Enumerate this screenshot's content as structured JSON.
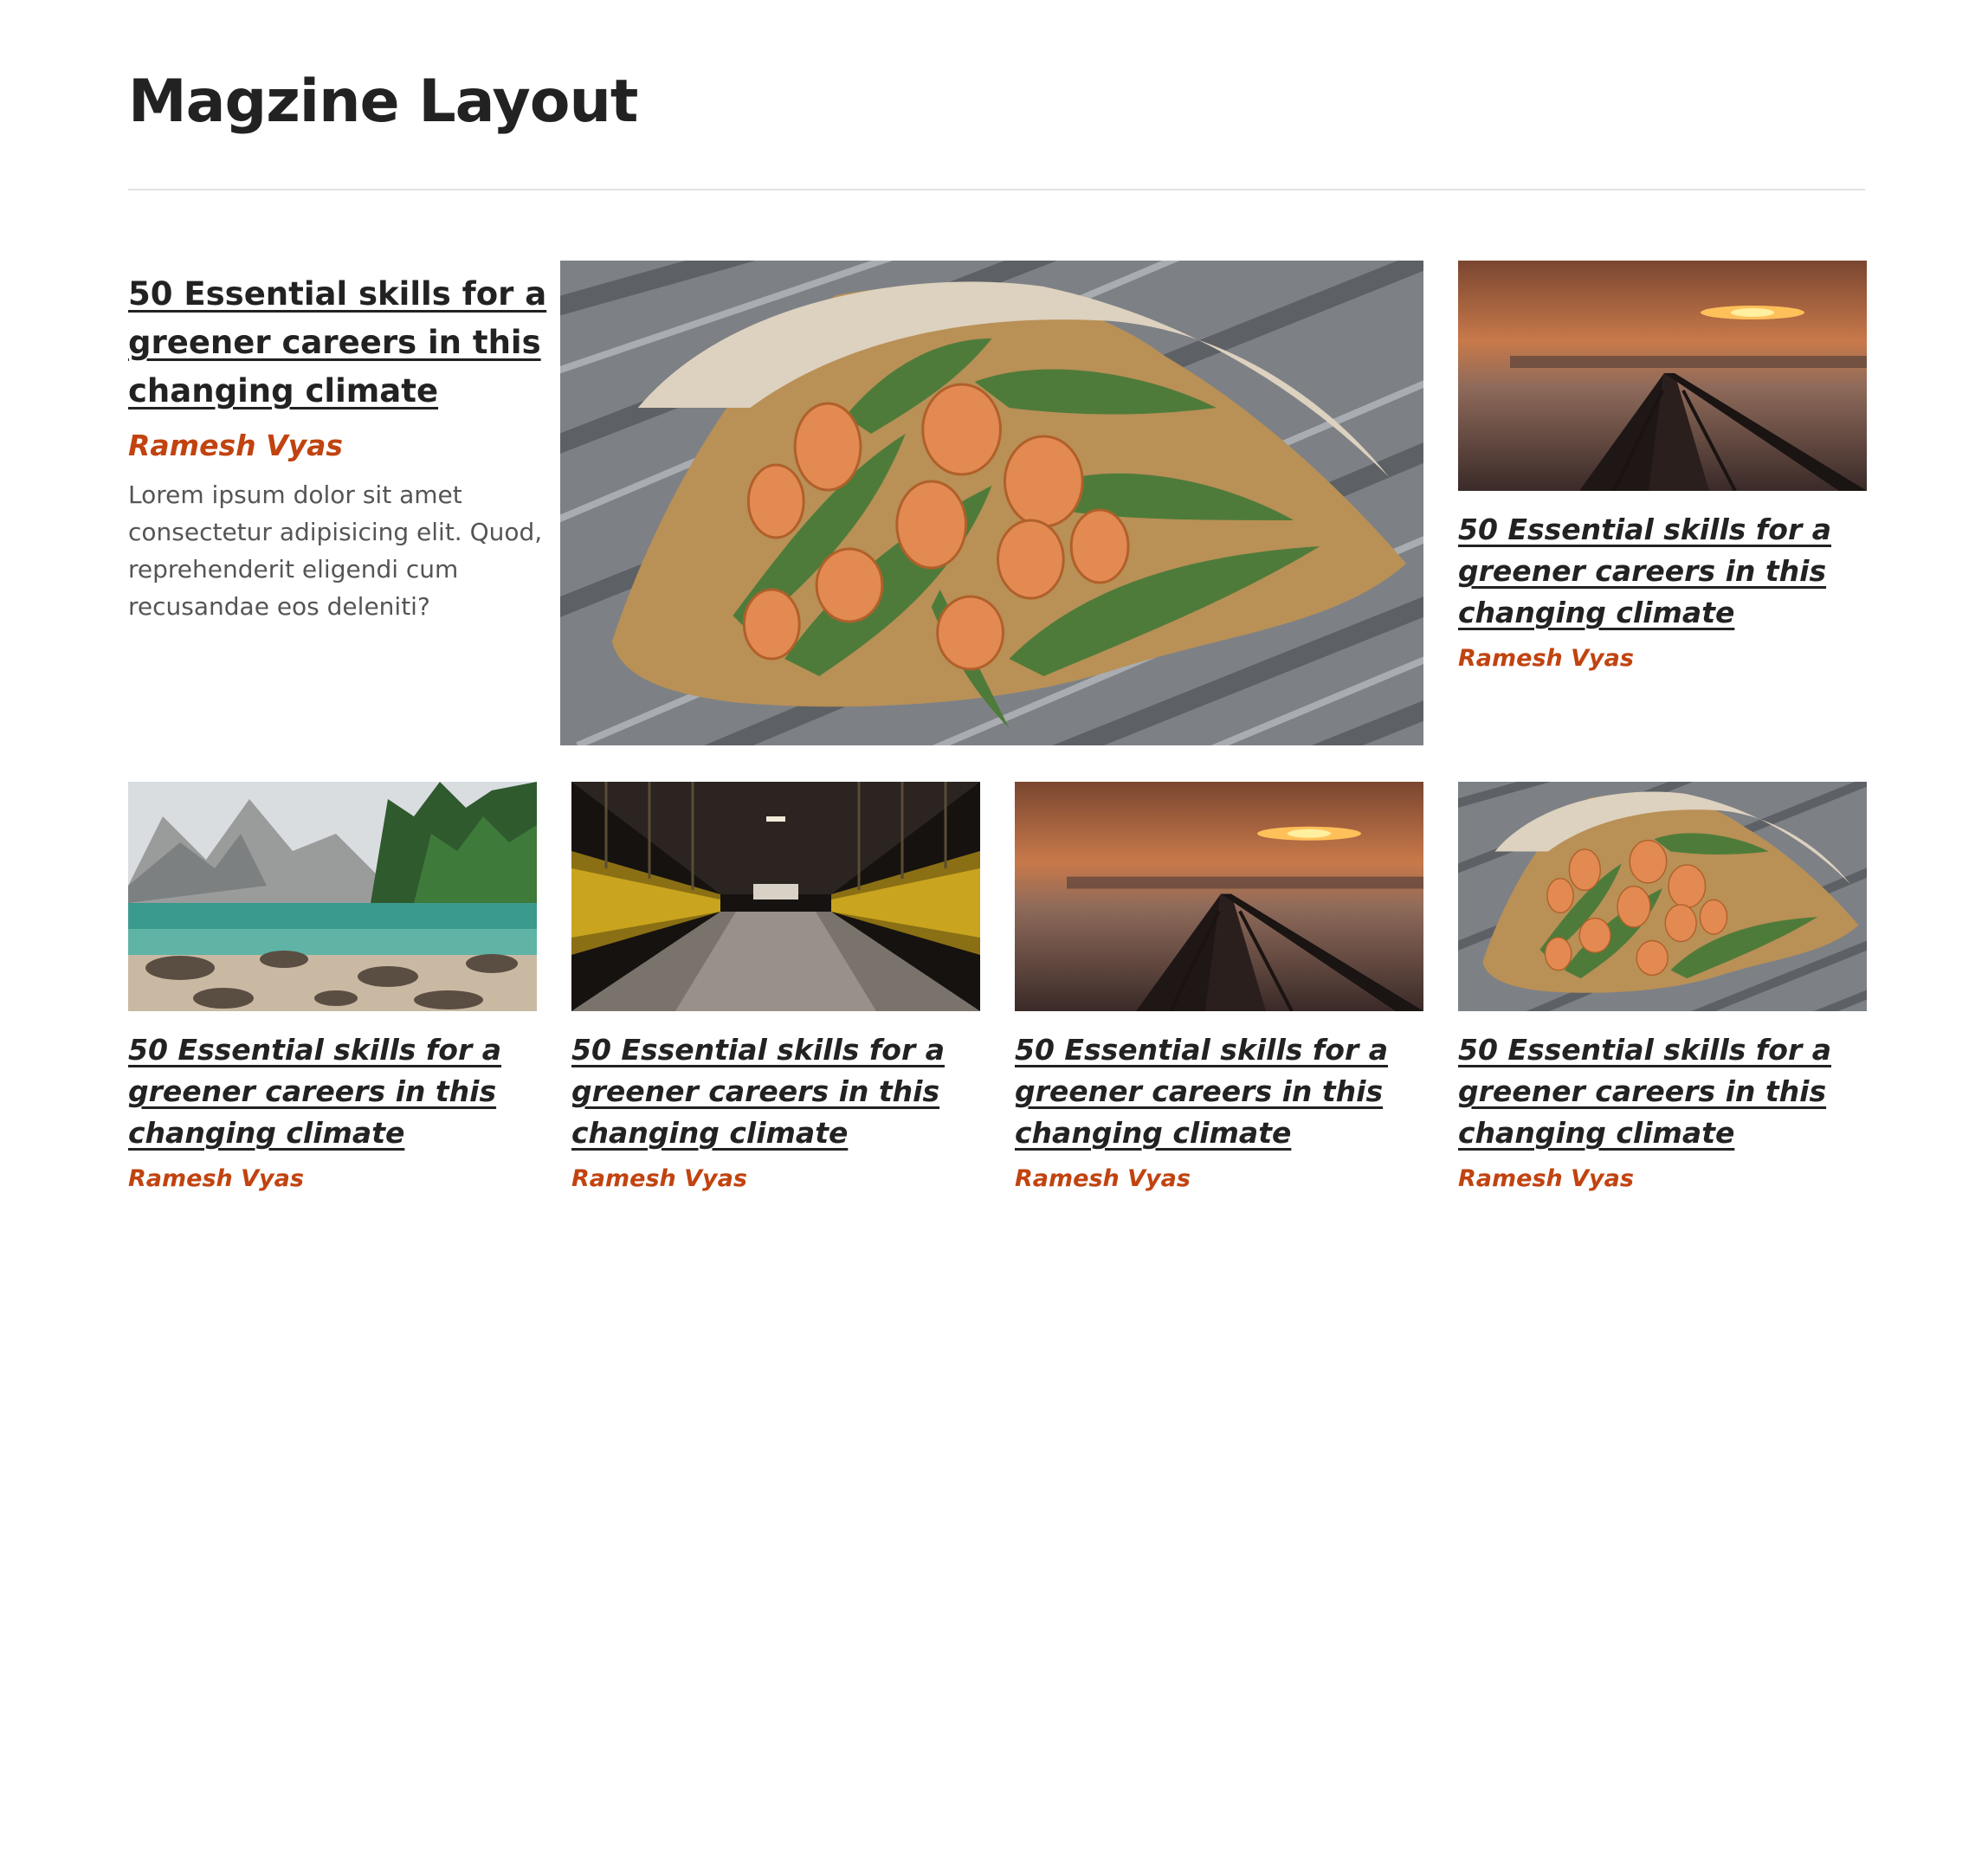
{
  "page": {
    "title": "Magzine Layout"
  },
  "featured": {
    "title": "50 Essential skills for a greener careers in this changing climate",
    "author": "Ramesh Vyas",
    "excerpt": "Lorem ipsum dolor sit amet consectetur adipisicing elit. Quod, reprehenderit eligendi cum recusandae eos deleniti?",
    "image": "tulip-bouquet-photo"
  },
  "side_card": {
    "title": "50 Essential skills for a greener careers in this changing climate",
    "author": "Ramesh Vyas",
    "image": "sunset-pier-photo"
  },
  "cards": [
    {
      "title": "50 Essential skills for a greener careers in this changing climate",
      "author": "Ramesh Vyas",
      "image": "mountain-lake-photo"
    },
    {
      "title": "50 Essential skills for a greener careers in this changing climate",
      "author": "Ramesh Vyas",
      "image": "corridor-photo"
    },
    {
      "title": "50 Essential skills for a greener careers in this changing climate",
      "author": "Ramesh Vyas",
      "image": "sunset-pier-photo"
    },
    {
      "title": "50 Essential skills for a greener careers in this changing climate",
      "author": "Ramesh Vyas",
      "image": "tulip-bouquet-photo"
    }
  ]
}
